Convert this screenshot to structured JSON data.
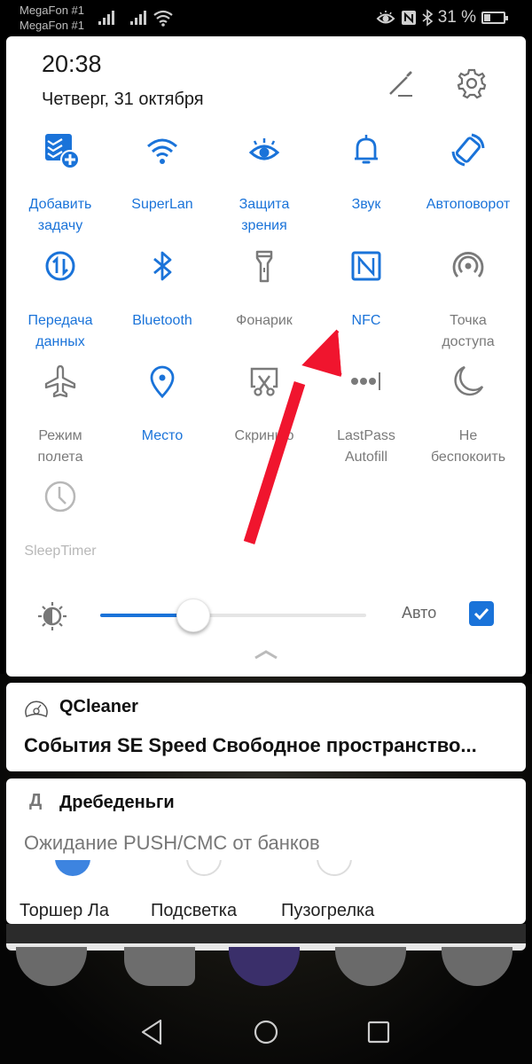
{
  "status_bar": {
    "carrier_1": "MegaFon #1",
    "carrier_2": "MegaFon #1",
    "battery_text": "31 %",
    "battery_level": 0.31,
    "icons": [
      "signal-icon",
      "signal-icon",
      "wifi-icon",
      "eye-comfort-icon",
      "nfc-icon",
      "bluetooth-icon",
      "battery-icon"
    ]
  },
  "header": {
    "time": "20:38",
    "date": "Четверг, 31 октября",
    "edit_icon": "pencil-icon",
    "settings_icon": "gear-icon"
  },
  "colors": {
    "accent": "#1a73d9",
    "inactive": "#7a7a7a",
    "disabled": "#b8b8b8",
    "arrow": "#f0152e"
  },
  "tiles": [
    {
      "label": "Добавить\nзадачу",
      "line1": "Добавить",
      "line2": "задачу",
      "icon": "add-task-icon",
      "state": "on"
    },
    {
      "label": "SuperLan",
      "line1": "SuperLan",
      "line2": "",
      "icon": "wifi-icon",
      "state": "on"
    },
    {
      "label": "Защита зрения",
      "line1": "Защита",
      "line2": "зрения",
      "icon": "eye-icon",
      "state": "on"
    },
    {
      "label": "Звук",
      "line1": "Звук",
      "line2": "",
      "icon": "bell-icon",
      "state": "on"
    },
    {
      "label": "Автоповорот",
      "line1": "Автоповорот",
      "line2": "",
      "icon": "auto-rotate-icon",
      "state": "on"
    },
    {
      "label": "Передача данных",
      "line1": "Передача",
      "line2": "данных",
      "icon": "mobile-data-icon",
      "state": "on"
    },
    {
      "label": "Bluetooth",
      "line1": "Bluetooth",
      "line2": "",
      "icon": "bluetooth-icon",
      "state": "on"
    },
    {
      "label": "Фонарик",
      "line1": "Фонарик",
      "line2": "",
      "icon": "flashlight-icon",
      "state": "off"
    },
    {
      "label": "NFC",
      "line1": "NFC",
      "line2": "",
      "icon": "nfc-icon",
      "state": "on"
    },
    {
      "label": "Точка доступа",
      "line1": "Точка",
      "line2": "доступа",
      "icon": "hotspot-icon",
      "state": "off"
    },
    {
      "label": "Режим полета",
      "line1": "Режим",
      "line2": "полета",
      "icon": "airplane-icon",
      "state": "off"
    },
    {
      "label": "Место",
      "line1": "Место",
      "line2": "",
      "icon": "location-icon",
      "state": "on"
    },
    {
      "label": "Скриншот",
      "line1": "Скриншо",
      "line2": "",
      "icon": "screenshot-icon",
      "state": "off"
    },
    {
      "label": "LastPass Autofill",
      "line1": "LastPass",
      "line2": "Autofill",
      "icon": "lastpass-icon",
      "state": "off"
    },
    {
      "label": "Не беспокоить",
      "line1": "Не",
      "line2": "беспокоить",
      "icon": "moon-icon",
      "state": "off"
    },
    {
      "label": "SleepTimer",
      "line1": "SleepTimer",
      "line2": "",
      "icon": "clock-icon",
      "state": "disabled"
    }
  ],
  "brightness": {
    "level": 0.35,
    "auto_label": "Авто",
    "auto_checked": true
  },
  "notifications": [
    {
      "app": "QCleaner",
      "icon": "speedometer-icon",
      "body": "События SE Speed Свободное пространство..."
    },
    {
      "app": "Дребеденьги",
      "icon_letter": "Д",
      "body": "Ожидание PUSH/CMC от банков"
    }
  ],
  "widget_items": [
    {
      "label": "Торшер Ла",
      "state": "on"
    },
    {
      "label": "Подсветка",
      "state": "off"
    },
    {
      "label": "Пузогрелка",
      "state": "off"
    }
  ],
  "nav": {
    "back": "back-icon",
    "home": "home-icon",
    "recents": "recents-icon"
  }
}
